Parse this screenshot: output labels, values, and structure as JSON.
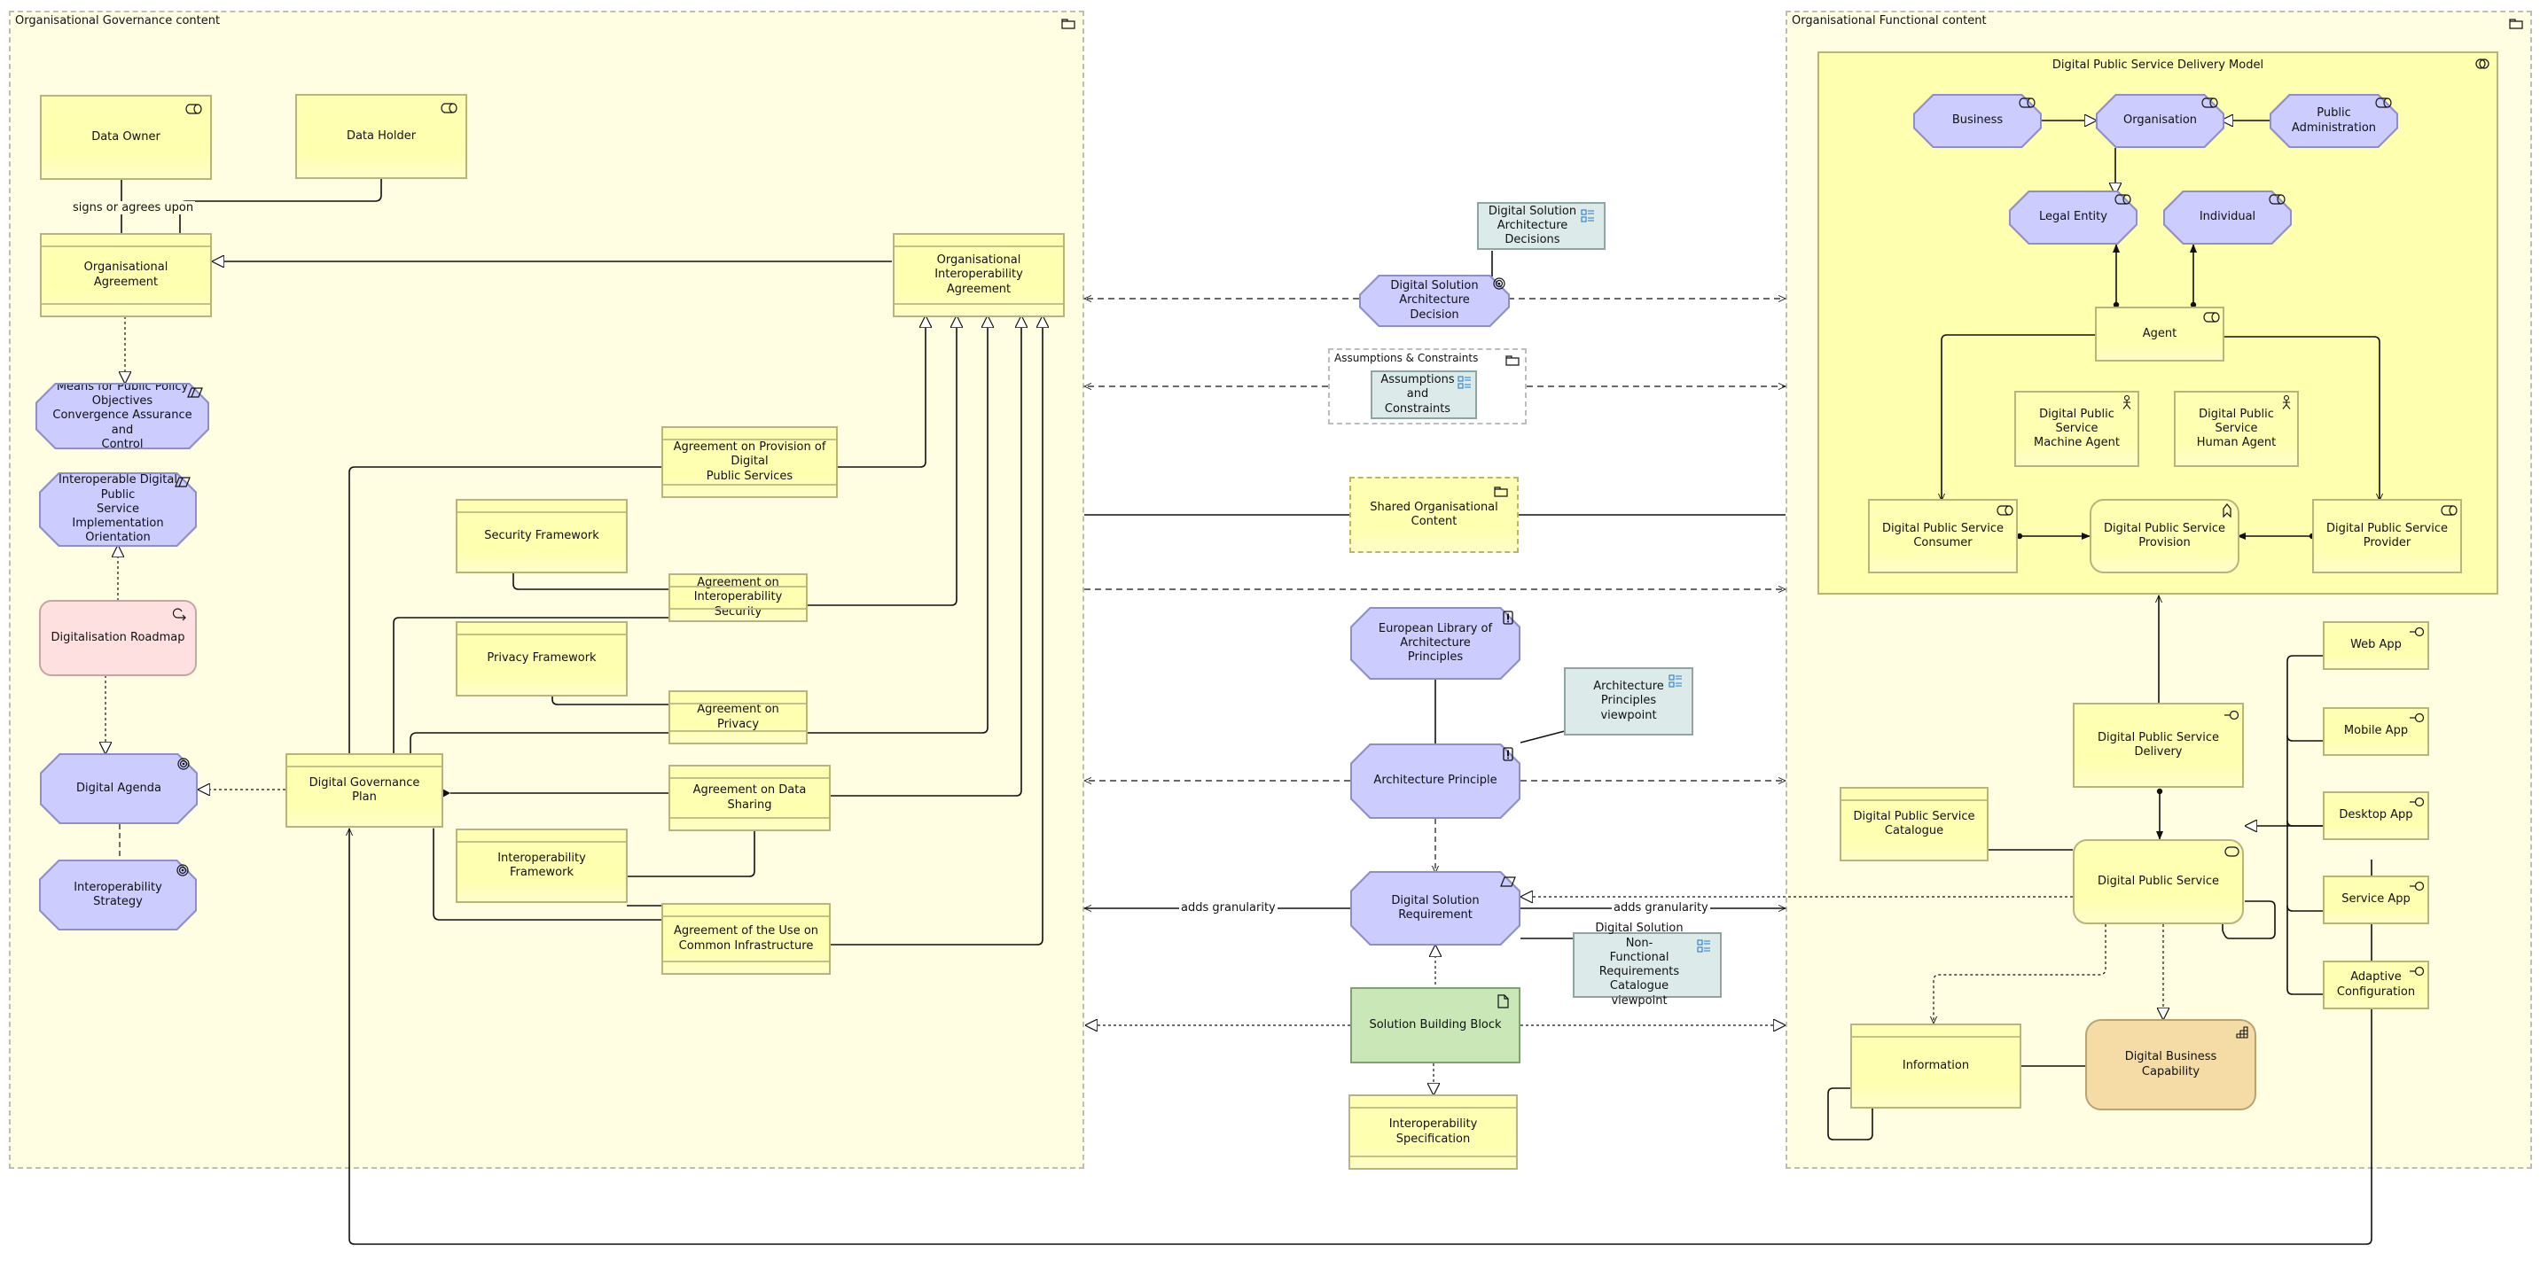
{
  "diagram": {
    "groups": {
      "governance": {
        "label": "Organisational Governance content",
        "icon": "folder-icon"
      },
      "functional": {
        "label": "Organisational Functional content",
        "icon": "folder-icon"
      },
      "assumptions": {
        "label": "Assumptions & Constraints",
        "icon": "folder-icon"
      },
      "delivery_model": {
        "label": "Digital Public Service Delivery Model",
        "icon": "collaboration-icon"
      }
    },
    "governance_nodes": {
      "data_owner": {
        "label": "Data Owner",
        "type": "business-role",
        "icon": "role-icon"
      },
      "data_holder": {
        "label": "Data Holder",
        "type": "business-role",
        "icon": "role-icon"
      },
      "org_agreement": {
        "label": "Organisational Agreement",
        "type": "contract"
      },
      "org_interop_agreement": {
        "label": "Organisational Interoperability\nAgreement",
        "type": "contract"
      },
      "means_public_policy": {
        "label": "Means for Public Policy Objectives\nConvergence Assurance and\nControl",
        "type": "requirement",
        "icon": "requirement-icon"
      },
      "interop_digital_orientation": {
        "label": "Interoperable Digital Public\nService Implementation\nOrientation",
        "type": "requirement",
        "icon": "requirement-icon"
      },
      "digitalisation_roadmap": {
        "label": "Digitalisation Roadmap",
        "type": "business-process",
        "icon": "process-icon"
      },
      "digital_agenda": {
        "label": "Digital Agenda",
        "type": "goal",
        "icon": "goal-icon"
      },
      "interop_strategy": {
        "label": "Interoperability Strategy",
        "type": "goal",
        "icon": "goal-icon"
      },
      "digital_governance_plan": {
        "label": "Digital Governance Plan",
        "type": "contract"
      },
      "agreement_provision": {
        "label": "Agreement on Provision of Digital\nPublic Services",
        "type": "contract"
      },
      "security_framework": {
        "label": "Security Framework",
        "type": "contract"
      },
      "agreement_interop_security": {
        "label": "Agreement on\nInteroperability Security",
        "type": "contract"
      },
      "privacy_framework": {
        "label": "Privacy Framework",
        "type": "contract"
      },
      "agreement_privacy": {
        "label": "Agreement on Privacy",
        "type": "contract"
      },
      "agreement_data_sharing": {
        "label": "Agreement on Data Sharing",
        "type": "contract"
      },
      "interop_framework": {
        "label": "Interoperability Framework",
        "type": "contract"
      },
      "agreement_common_infra": {
        "label": "Agreement of the Use on\nCommon Infrastructure",
        "type": "contract"
      }
    },
    "center_nodes": {
      "dsa_decisions": {
        "label": "Digital Solution\nArchitecture\nDecisions",
        "type": "viewpoint-note",
        "icon": "viewpoint-icon"
      },
      "dsa_decision": {
        "label": "Digital Solution Architecture\nDecision",
        "type": "goal",
        "icon": "goal-icon"
      },
      "assumptions_constraints": {
        "label": "Assumptions\nand\nConstraints",
        "type": "viewpoint-note",
        "icon": "viewpoint-icon"
      },
      "shared_org_content": {
        "label": "Shared Organisational Content",
        "type": "grouping",
        "icon": "folder-icon"
      },
      "european_library": {
        "label": "European Library of Architecture\nPrinciples",
        "type": "principle",
        "icon": "principle-icon"
      },
      "architecture_principle": {
        "label": "Architecture Principle",
        "type": "principle",
        "icon": "principle-icon"
      },
      "arch_principles_viewpoint": {
        "label": "Architecture Principles\nviewpoint",
        "type": "viewpoint-note",
        "icon": "viewpoint-icon"
      },
      "digital_solution_requirement": {
        "label": "Digital Solution Requirement",
        "type": "requirement",
        "icon": "requirement-icon"
      },
      "dsnfr_catalogue": {
        "label": "Digital Solution Non-\nFunctional\nRequirements\nCatalogue viewpoint",
        "type": "viewpoint-note",
        "icon": "viewpoint-icon"
      },
      "solution_building_block": {
        "label": "Solution Building Block",
        "type": "deliverable",
        "icon": "deliverable-icon"
      },
      "interop_specification": {
        "label": "Interoperability Specification",
        "type": "contract"
      }
    },
    "functional_nodes": {
      "business": {
        "label": "Business",
        "type": "stakeholder",
        "icon": "role-icon"
      },
      "organisation": {
        "label": "Organisation",
        "type": "stakeholder",
        "icon": "role-icon"
      },
      "public_administration": {
        "label": "Public Administration",
        "type": "stakeholder",
        "icon": "role-icon"
      },
      "legal_entity": {
        "label": "Legal Entity",
        "type": "stakeholder",
        "icon": "role-icon"
      },
      "individual": {
        "label": "Individual",
        "type": "stakeholder",
        "icon": "role-icon"
      },
      "agent": {
        "label": "Agent",
        "type": "business-role",
        "icon": "role-icon"
      },
      "machine_agent": {
        "label": "Digital Public Service\nMachine Agent",
        "type": "business-actor",
        "icon": "actor-icon"
      },
      "human_agent": {
        "label": "Digital Public Service\nHuman Agent",
        "type": "business-actor",
        "icon": "actor-icon"
      },
      "consumer": {
        "label": "Digital Public Service\nConsumer",
        "type": "business-role",
        "icon": "role-icon"
      },
      "provision": {
        "label": "Digital Public Service\nProvision",
        "type": "business-function",
        "icon": "function-icon"
      },
      "provider": {
        "label": "Digital Public Service Provider",
        "type": "business-role",
        "icon": "role-icon"
      },
      "web_app": {
        "label": "Web App",
        "type": "business-interface",
        "icon": "interface-icon"
      },
      "mobile_app": {
        "label": "Mobile App",
        "type": "business-interface",
        "icon": "interface-icon"
      },
      "desktop_app": {
        "label": "Desktop App",
        "type": "business-interface",
        "icon": "interface-icon"
      },
      "service_app": {
        "label": "Service App",
        "type": "business-interface",
        "icon": "interface-icon"
      },
      "adaptive_config": {
        "label": "Adaptive\nConfiguration",
        "type": "business-interface",
        "icon": "interface-icon"
      },
      "dps_delivery": {
        "label": "Digital Public Service Delivery",
        "type": "business-interface",
        "icon": "interface-icon"
      },
      "dps_catalogue": {
        "label": "Digital Public Service\nCatalogue",
        "type": "contract"
      },
      "digital_public_service": {
        "label": "Digital Public Service",
        "type": "business-service",
        "icon": "service-icon"
      },
      "information": {
        "label": "Information",
        "type": "business-object"
      },
      "digital_business_capability": {
        "label": "Digital Business Capability",
        "type": "capability",
        "icon": "capability-icon"
      }
    },
    "connection_labels": {
      "signs_or_agrees_upon": "signs or agrees upon",
      "adds_granularity_left": "adds granularity",
      "adds_granularity_right": "adds granularity"
    },
    "colors": {
      "business_layer": "#ffffb0",
      "motivation": "#ccccff",
      "implementation_work": "#ffe0e0",
      "deliverable": "#c9e7b7",
      "viewpoint_note": "#dcebea",
      "capability": "#f5dca6",
      "group_background": "#fffee3"
    }
  }
}
